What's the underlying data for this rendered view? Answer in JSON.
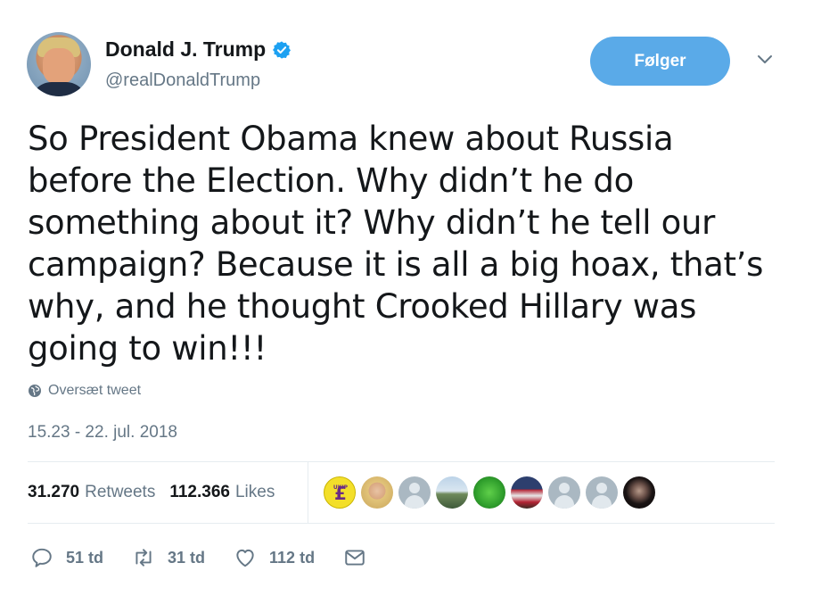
{
  "author": {
    "name": "Donald J. Trump",
    "handle": "@realDonaldTrump",
    "verified_icon": "verified-badge-icon"
  },
  "follow_button": {
    "label": "Følger",
    "color": "#5aaae8"
  },
  "tweet": {
    "text": "So President Obama knew about Russia before the Election. Why didn’t he do something about it? Why didn’t he tell our campaign? Because it is all a big hoax, that’s why, and he thought Crooked Hillary was going to win!!!",
    "translate_label": "Oversæt tweet",
    "timestamp": "15.23 - 22. jul. 2018"
  },
  "stats": {
    "retweets_count": "31.270",
    "retweets_label": "Retweets",
    "likes_count": "112.366",
    "likes_label": "Likes"
  },
  "likers": [
    {
      "icon": "ukip-logo-avatar",
      "text": "UKIP"
    },
    {
      "icon": "blonde-woman-avatar"
    },
    {
      "icon": "default-avatar"
    },
    {
      "icon": "landscape-avatar"
    },
    {
      "icon": "green-emblem-avatar"
    },
    {
      "icon": "flag-avatar"
    },
    {
      "icon": "default-avatar"
    },
    {
      "icon": "default-avatar"
    },
    {
      "icon": "dark-hair-avatar"
    }
  ],
  "actions": {
    "reply_count": "51 td",
    "retweet_count": "31 td",
    "like_count": "112 td"
  },
  "colors": {
    "text": "#14171a",
    "muted": "#657786",
    "accent": "#1da1f2",
    "divider": "#e6ecf0"
  }
}
